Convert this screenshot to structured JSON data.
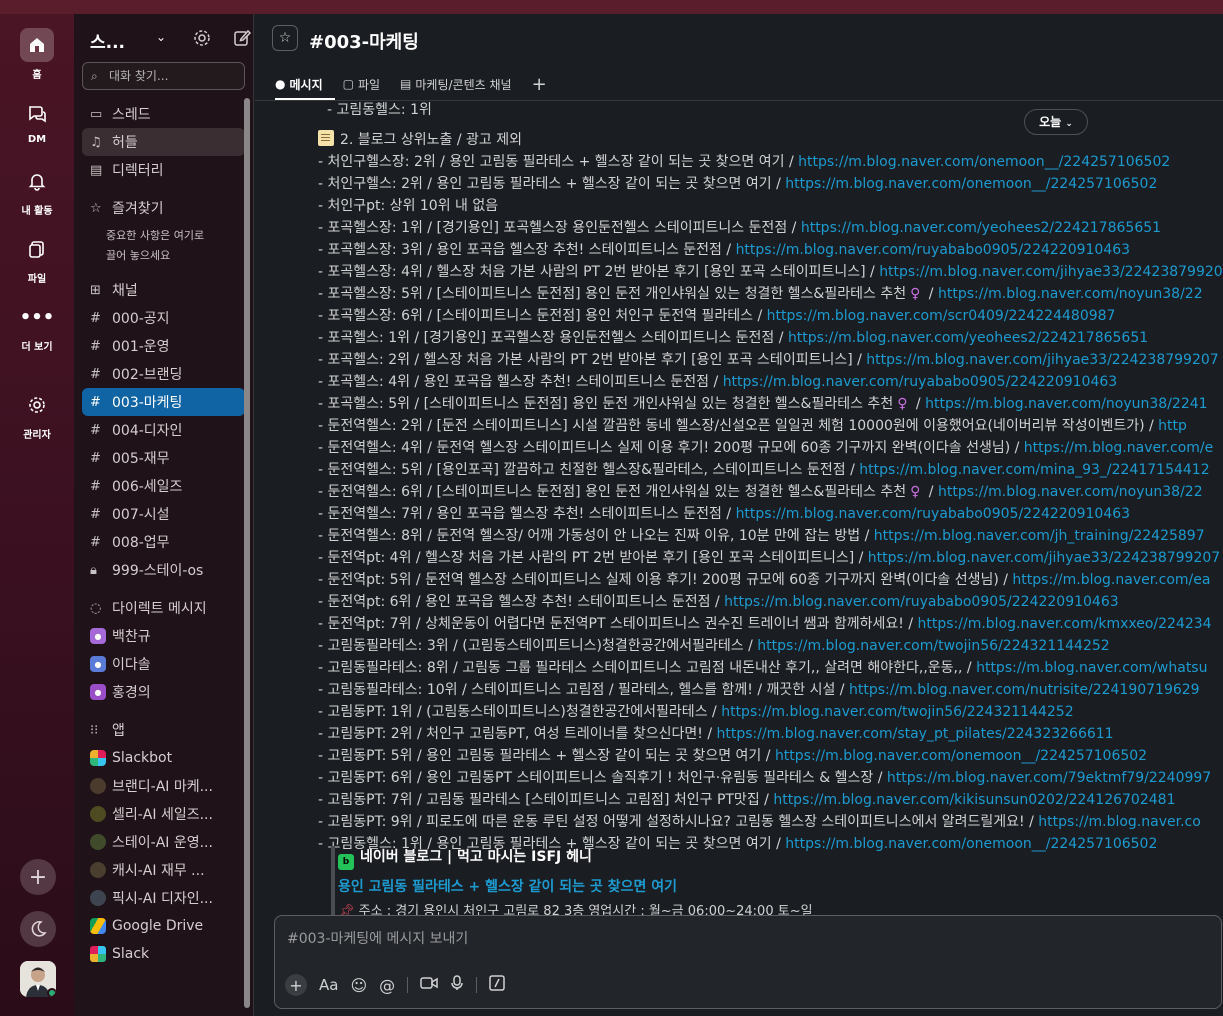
{
  "rail": {
    "items": [
      {
        "label": "홈"
      },
      {
        "label": "DM"
      },
      {
        "label": "내 활동"
      },
      {
        "label": "파일"
      },
      {
        "label": "더 보기"
      },
      {
        "label": "관리자"
      }
    ]
  },
  "sidebar": {
    "workspace": "스...",
    "search_placeholder": "대화 찾기...",
    "top_items": [
      "스레드",
      "허들",
      "디렉터리"
    ],
    "favorites_header": "즐겨찾기",
    "favorites_note": [
      "중요한 사항은 여기로",
      "끌어 놓으세요"
    ],
    "channels_header": "채널",
    "channels": [
      "000-공지",
      "001-운영",
      "002-브랜딩",
      "003-마케팅",
      "004-디자인",
      "005-재무",
      "006-세일즈",
      "007-시설",
      "008-업무",
      "999-스테이-os"
    ],
    "dm_header": "다이렉트 메시지",
    "dms": [
      "백찬규",
      "이다솔",
      "홍경의"
    ],
    "apps_header": "앱",
    "apps": [
      "Slackbot",
      "브랜디-AI 마케...",
      "셀리-AI 세일즈...",
      "스테이-AI 운영...",
      "캐시-AI 재무 ...",
      "픽시-AI 디자인...",
      "Google Drive",
      "Slack"
    ]
  },
  "header": {
    "channel_title": "#003-마케팅",
    "tabs": [
      "메시지",
      "파일",
      "마케팅/콘텐츠 채널"
    ],
    "add_tab": "+"
  },
  "feed": {
    "today": "오늘",
    "top_line": "- 고림동헬스: 1위",
    "section_title": "2. 블로그 상위노출 / 광고 제외",
    "lines": [
      {
        "text": "- 처인구헬스장: 2위 / 용인 고림동 필라테스 + 헬스장 같이 되는 곳 찾으면 여기 / ",
        "link": "https://m.blog.naver.com/onemoon__/224257106502"
      },
      {
        "text": "- 처인구헬스: 2위 / 용인 고림동 필라테스 + 헬스장 같이 되는 곳 찾으면 여기 / ",
        "link": "https://m.blog.naver.com/onemoon__/224257106502"
      },
      {
        "text": "- 처인구pt: 상위 10위 내 없음",
        "link": ""
      },
      {
        "text": "- 포곡헬스장: 1위 / [경기용인] 포곡헬스장 용인둔전헬스 스테이피트니스 둔전점 / ",
        "link": "https://m.blog.naver.com/yeohees2/224217865651"
      },
      {
        "text": "- 포곡헬스장: 3위 / 용인 포곡읍 헬스장 추천! 스테이피트니스 둔전점 / ",
        "link": "https://m.blog.naver.com/ruyababo0905/224220910463"
      },
      {
        "text": "- 포곡헬스장: 4위 / 헬스장 처음 가본 사람의 PT 2번 받아본 후기 [용인 포곡 스테이피트니스] / ",
        "link": "https://m.blog.naver.com/jihyae33/22423879920"
      },
      {
        "text": "- 포곡헬스장: 5위 / [스테이피트니스 둔전점] 용인 둔전 개인샤워실 있는 청결한 헬스&필라테스 추천",
        "female": "♀",
        "after": " / ",
        "link": "https://m.blog.naver.com/noyun38/22"
      },
      {
        "text": "- 포곡헬스장: 6위 / [스테이피트니스 둔전점] 용인 처인구 둔전역 필라테스 / ",
        "link": "https://m.blog.naver.com/scr0409/224224480987"
      },
      {
        "text": "- 포곡헬스: 1위 / [경기용인] 포곡헬스장 용인둔전헬스 스테이피트니스 둔전점 / ",
        "link": "https://m.blog.naver.com/yeohees2/224217865651"
      },
      {
        "text": "- 포곡헬스: 2위 / 헬스장 처음 가본 사람의 PT 2번 받아본 후기 [용인 포곡 스테이피트니스] / ",
        "link": "https://m.blog.naver.com/jihyae33/224238799207"
      },
      {
        "text": "- 포곡헬스: 4위 / 용인 포곡읍 헬스장 추천! 스테이피트니스 둔전점 / ",
        "link": "https://m.blog.naver.com/ruyababo0905/224220910463"
      },
      {
        "text": "- 포곡헬스: 5위 / [스테이피트니스 둔전점] 용인 둔전 개인샤워실 있는 청결한 헬스&필라테스 추천",
        "female": "♀",
        "after": " / ",
        "link": "https://m.blog.naver.com/noyun38/2241"
      },
      {
        "text": "- 둔전역헬스: 2위 / [둔전 스테이피트니스] 시설 깔끔한 동네 헬스장/신설오픈 일일권 체험 10000원에 이용했어요(네이버리뷰 작성이벤트가) / ",
        "link": "http"
      },
      {
        "text": "- 둔전역헬스: 4위 / 둔전역 헬스장 스테이피트니스 실제 이용 후기! 200평 규모에 60종 기구까지 완벽(이다솔 선생님) / ",
        "link": "https://m.blog.naver.com/e"
      },
      {
        "text": "- 둔전역헬스: 5위 / [용인포곡] 깔끔하고 친절한 헬스장&필라테스, 스테이피트니스 둔전점 / ",
        "link": "https://m.blog.naver.com/mina_93_/22417154412"
      },
      {
        "text": "- 둔전역헬스: 6위 / [스테이피트니스 둔전점] 용인 둔전 개인샤워실 있는 청결한 헬스&필라테스 추천",
        "female": "♀",
        "after": " / ",
        "link": "https://m.blog.naver.com/noyun38/22"
      },
      {
        "text": "- 둔전역헬스: 7위 / 용인 포곡읍 헬스장 추천! 스테이피트니스 둔전점 / ",
        "link": "https://m.blog.naver.com/ruyababo0905/224220910463"
      },
      {
        "text": "- 둔전역헬스: 8위 / 둔전역 헬스장/ 어깨 가동성이 안 나오는 진짜 이유, 10분 만에 잡는 방법 / ",
        "link": "https://m.blog.naver.com/jh_training/22425897"
      },
      {
        "text": "- 둔전역pt: 4위 / 헬스장 처음 가본 사람의 PT 2번 받아본 후기 [용인 포곡 스테이피트니스] / ",
        "link": "https://m.blog.naver.com/jihyae33/224238799207"
      },
      {
        "text": "- 둔전역pt: 5위 / 둔전역 헬스장 스테이피트니스 실제 이용 후기! 200평 규모에 60종 기구까지 완벽(이다솔 선생님) / ",
        "link": "https://m.blog.naver.com/ea"
      },
      {
        "text": "- 둔전역pt: 6위 / 용인 포곡읍 헬스장 추천! 스테이피트니스 둔전점 / ",
        "link": "https://m.blog.naver.com/ruyababo0905/224220910463"
      },
      {
        "text": "- 둔전역pt: 7위 / 상체운동이 어렵다면 둔전역PT 스테이피트니스 권수진 트레이너 쌤과 함께하세요! / ",
        "link": "https://m.blog.naver.com/kmxxeo/224234"
      },
      {
        "text": "- 고림동필라테스: 3위 / (고림동스테이피트니스)청결한공간에서필라테스 / ",
        "link": "https://m.blog.naver.com/twojin56/224321144252"
      },
      {
        "text": "- 고림동필라테스: 8위 / 고림동 그룹 필라테스 스테이피트니스 고림점 내돈내산 후기,, 살려면 해야한다,,운동,, / ",
        "link": "https://m.blog.naver.com/whatsu"
      },
      {
        "text": "- 고림동필라테스: 10위 / 스테이피트니스 고림점 / 필라테스, 헬스를 함께! / 깨끗한 시설 / ",
        "link": "https://m.blog.naver.com/nutrisite/224190719629"
      },
      {
        "text": "- 고림동PT: 1위 / (고림동스테이피트니스)청결한공간에서필라테스 / ",
        "link": "https://m.blog.naver.com/twojin56/224321144252"
      },
      {
        "text": "- 고림동PT: 2위 / 처인구 고림동PT, 여성 트레이너를 찾으신다면! / ",
        "link": "https://m.blog.naver.com/stay_pt_pilates/224323266611"
      },
      {
        "text": "- 고림동PT: 5위 / 용인 고림동 필라테스 + 헬스장 같이 되는 곳 찾으면 여기 / ",
        "link": "https://m.blog.naver.com/onemoon__/224257106502"
      },
      {
        "text": "- 고림동PT: 6위 / 용인 고림동PT 스테이피트니스 솔직후기 ! 처인구·유림동 필라테스 & 헬스장 / ",
        "link": "https://m.blog.naver.com/79ektmf79/2240997"
      },
      {
        "text": "- 고림동PT: 7위 / 고림동 필라테스 [스테이피트니스 고림점] 처인구 PT맛집 / ",
        "link": "https://m.blog.naver.com/kikisunsun0202/224126702481"
      },
      {
        "text": "- 고림동PT: 9위 / 피로도에 따른 운동 루틴 설정 어떻게 설정하시나요? 고림동 헬스장 스테이피트니스에서 알려드릴게요! / ",
        "link": "https://m.blog.naver.co"
      },
      {
        "text": "- 고림동헬스: 1위 / 용인 고림동 필라테스 + 헬스장 같이 되는 곳 찾으면 여기 / ",
        "link": "https://m.blog.naver.com/onemoon__/224257106502"
      }
    ],
    "preview": {
      "source": "네이버 블로그 | 먹고 마시는 ISFJ 헤니",
      "title": "용인 고림동 필라테스 + 헬스장 같이 되는 곳 찾으면 여기",
      "snippet": "주소 : 경기 용인시 처인구 고림로 82 3층   영업시간 : 월~금 06:00~24:00 토~일"
    }
  },
  "composer": {
    "placeholder": "#003-마케팅에 메시지 보내기"
  }
}
